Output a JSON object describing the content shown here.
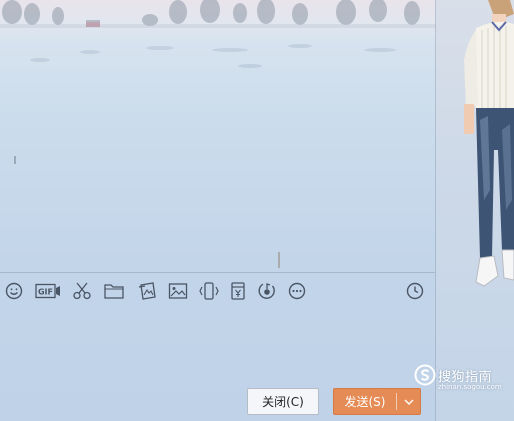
{
  "toolbar": {
    "icons": [
      {
        "name": "emoji-icon"
      },
      {
        "name": "gif-icon",
        "label": "GIF"
      },
      {
        "name": "scissors-icon"
      },
      {
        "name": "folder-icon"
      },
      {
        "name": "image-gallery-icon"
      },
      {
        "name": "picture-icon"
      },
      {
        "name": "shake-icon"
      },
      {
        "name": "red-packet-icon"
      },
      {
        "name": "music-icon"
      },
      {
        "name": "more-icon"
      },
      {
        "name": "clock-history-icon"
      }
    ]
  },
  "actions": {
    "close_label": "关闭(C)",
    "send_label": "发送(S)"
  },
  "watermark": {
    "text": "搜狗指南",
    "subtext": "zhinan.sogou.com"
  },
  "colors": {
    "send_button": "#e58b55",
    "toolbar_icon": "#4a5566"
  }
}
